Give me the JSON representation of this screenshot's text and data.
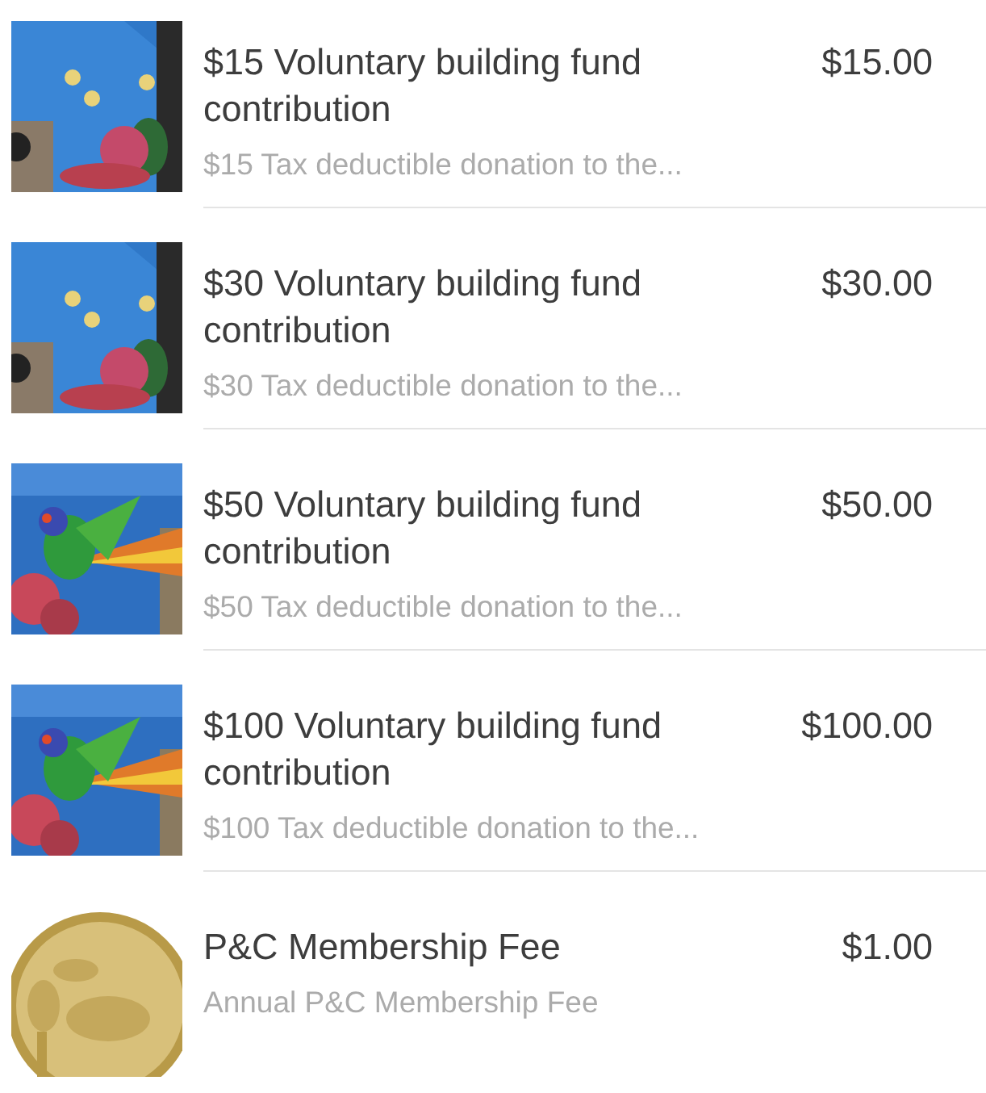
{
  "items": [
    {
      "title": "$15 Voluntary building fund contribution",
      "price": "$15.00",
      "description": "$15 Tax deductible donation to the..."
    },
    {
      "title": "$30 Voluntary building fund contribution",
      "price": "$30.00",
      "description": "$30 Tax deductible donation to the..."
    },
    {
      "title": "$50 Voluntary building fund contribution",
      "price": "$50.00",
      "description": "$50 Tax deductible donation to the..."
    },
    {
      "title": "$100 Voluntary building fund contribution",
      "price": "$100.00",
      "description": "$100 Tax deductible donation to the..."
    },
    {
      "title": "P&C Membership Fee",
      "price": "$1.00",
      "description": "Annual P&C Membership Fee"
    }
  ]
}
